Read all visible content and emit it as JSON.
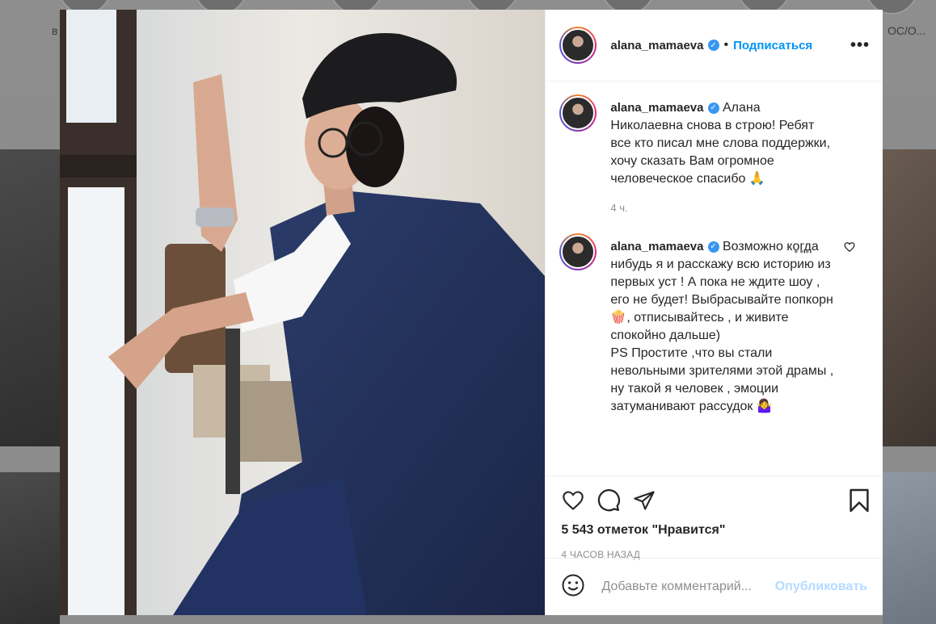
{
  "background": {
    "story_label_left": "в",
    "story_label_right": "ОС/О..."
  },
  "post": {
    "username": "alana_mamaeva",
    "follow_label": "Подписаться",
    "more_label": "•••",
    "separator": "•",
    "caption": "Алана Николаевна снова в строю! Ребят все кто писал мне слова поддержки, хочу сказать Вам огромное человеческое спасибо 🙏",
    "caption_time": "4 ч.",
    "comment_text_1": "Возможно когда нибудь я и расскажу всю историю из первых уст ! А пока не ждите шоу , его не будет! Выбрасывайте попкорн 🍿, отписывайтесь , и живите спокойно дальше)",
    "comment_text_2": "PS Простите ,что вы стали невольными зрителями этой драмы , ну такой я человек , эмоции затуманивают рассудок 🤷‍♀️",
    "likes": "5 543 отметок \"Нравится\"",
    "posted_ago": "4 ЧАСОВ НАЗАД",
    "comment_placeholder": "Добавьте комментарий...",
    "publish_label": "Опубликовать"
  },
  "colors": {
    "accent": "#0095f6",
    "verified": "#3897f0",
    "muted": "#8e8e8e",
    "publish_disabled": "#b3dbff"
  },
  "icons": [
    "heart-icon",
    "comment-icon",
    "share-icon",
    "bookmark-icon",
    "smiley-icon",
    "verified-icon",
    "more-icon"
  ]
}
